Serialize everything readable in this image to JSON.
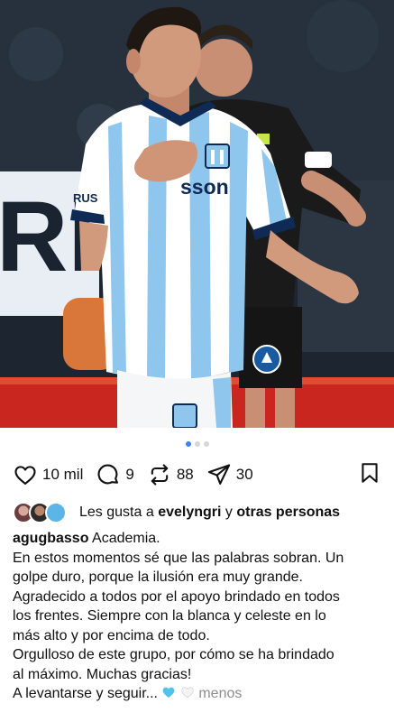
{
  "post": {
    "carousel": {
      "total": 3,
      "active": 1
    },
    "actions": {
      "likes": "10 mil",
      "comments": "9",
      "reposts": "88",
      "shares": "30"
    },
    "liked_by": {
      "prefix": "Les gusta a",
      "user": "evelyngri",
      "connector": "y",
      "others": "otras personas"
    },
    "caption": {
      "username": "agugbasso",
      "first_line": "Academia.",
      "lines": [
        "En estos momentos sé que las palabras sobran. Un",
        "golpe duro, porque la ilusión era muy grande.",
        "Agradecido a todos por el apoyo brindado en todos",
        "los frentes. Siempre con la blanca y celeste en lo",
        "más alto y por encima de todo.",
        "Orgulloso de este grupo, por cómo se ha brindado",
        "al máximo. Muchas gracias!"
      ],
      "last_line": "A levantarse y seguir...",
      "more_label": "menos"
    },
    "photo": {
      "sponsor_text": "RUS",
      "chest_text": "sson",
      "accent_light_blue": "#8fc6ee",
      "accent_navy": "#0e2a55"
    }
  }
}
